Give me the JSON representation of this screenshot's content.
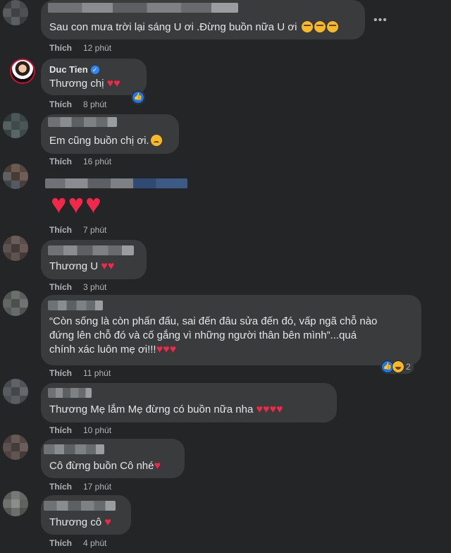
{
  "like_label": "Thích",
  "comments": [
    {
      "text": "Sau con mưa trời lại sáng U ơi .Đừng buồn nữa U ơi",
      "emoji": [
        "relieved",
        "relieved",
        "relieved"
      ],
      "time": "12 phút"
    },
    {
      "author": "Duc Tien",
      "verified": true,
      "text": "Thương chị",
      "hearts": 2,
      "time": "8 phút"
    },
    {
      "text": "Em cũng buồn chị ơi.",
      "emoji": [
        "sad"
      ],
      "time": "16 phút"
    },
    {
      "hearts": 3,
      "time": "7 phút"
    },
    {
      "text": "Thương U",
      "hearts": 2,
      "time": "3 phút"
    },
    {
      "lines": [
        "“Còn sống là còn phấn đấu, sai đến đâu sửa đến đó, vấp ngã chỗ nào",
        "đứng lên chỗ đó và cố gắng vì những người thân bên mình”...quá",
        "chính xác luôn mẹ ơi!!!"
      ],
      "hearts": 3,
      "time": "11 phút",
      "reaction_count": "2"
    },
    {
      "text": "Thương Mẹ lắm Mẹ đừng có buồn nữa nha",
      "hearts": 4,
      "time": "10 phút"
    },
    {
      "text": "Cô đừng buồn Cô nhé",
      "hearts": 1,
      "time": "17 phút"
    },
    {
      "text": "Thương cô",
      "hearts": 1,
      "time": "4 phút"
    }
  ],
  "icons": {
    "more": "more-options-icon",
    "verified": "verified-badge-icon",
    "like_reaction": "like-reaction-icon",
    "haha_reaction": "haha-reaction-icon"
  },
  "colors": {
    "background": "#242526",
    "bubble": "#3a3b3c",
    "heart": "#f02849",
    "verified": "#2d88ff"
  }
}
